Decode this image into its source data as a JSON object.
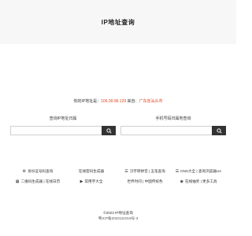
{
  "header": {
    "title": "IP地址查询"
  },
  "info": {
    "label_ip": "你的IP地址是：",
    "ip": "106.39.96.129",
    "label_from": "来自：",
    "location": "广东省汕头市"
  },
  "panels": {
    "ip_lookup": {
      "title": "查询IP地址归属",
      "input_value": ""
    },
    "phone_lookup": {
      "title": "手机号码归属地查询",
      "input_value": ""
    }
  },
  "links": [
    {
      "icon": "⚙",
      "label": "身份证号码查询"
    },
    {
      "icon": "",
      "label": "在线密码生成器"
    },
    {
      "icon": "☰",
      "label": "汉字转拼音 | 五笔查询"
    },
    {
      "icon": "☰",
      "label": "DNS大全 | 查询浏览器UA"
    },
    {
      "icon": "▦",
      "label": "二维码生成器 | 在线日历"
    },
    {
      "icon": "▶",
      "label": "常用字大全"
    },
    {
      "icon": "",
      "label": "世界时间 | 中国传统色"
    },
    {
      "icon": "◉",
      "label": "在线抽奖 | 更多工具"
    }
  ],
  "footer": {
    "copyright": "©2023 IP地址查询",
    "icp": "粤ICP备2023111019号-3"
  }
}
